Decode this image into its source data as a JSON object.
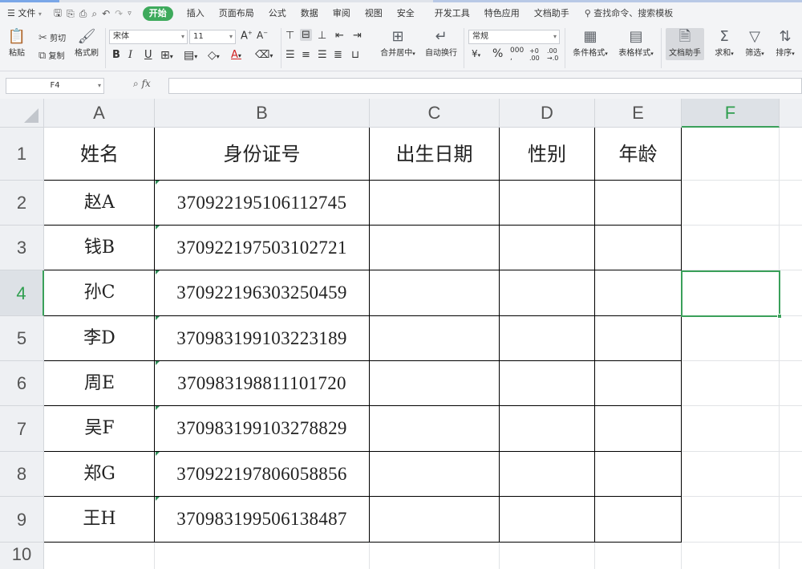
{
  "menu": {
    "file": "文件",
    "tabs": [
      "插入",
      "页面布局",
      "公式",
      "数据",
      "审阅",
      "视图",
      "安全",
      "开发工具",
      "特色应用",
      "文档助手"
    ],
    "active_tab": "开始",
    "search": "查找命令、搜索模板"
  },
  "ribbon": {
    "paste": "粘贴",
    "cut": "剪切",
    "copy": "复制",
    "format_painter": "格式刷",
    "font_name": "宋体",
    "font_size": "11",
    "merge_center": "合并居中",
    "wrap_text": "自动换行",
    "number_format": "常规",
    "conditional_format": "条件格式",
    "table_style": "表格样式",
    "doc_assistant": "文档助手",
    "sum": "求和",
    "filter": "筛选",
    "sort": "排序"
  },
  "formula_bar": {
    "name_box": "F4",
    "fx": "fx",
    "value": ""
  },
  "sheet": {
    "columns": [
      "A",
      "B",
      "C",
      "D",
      "E",
      "F"
    ],
    "active_column": "F",
    "active_row": "4",
    "rows": [
      "1",
      "2",
      "3",
      "4",
      "5",
      "6",
      "7",
      "8",
      "9",
      "10"
    ],
    "headers": [
      "姓名",
      "身份证号",
      "出生日期",
      "性别",
      "年龄"
    ],
    "records": [
      {
        "name": "赵A",
        "id": "370922195106112745"
      },
      {
        "name": "钱B",
        "id": "370922197503102721"
      },
      {
        "name": "孙C",
        "id": "370922196303250459"
      },
      {
        "name": "李D",
        "id": "370983199103223189"
      },
      {
        "name": "周E",
        "id": "370983198811101720"
      },
      {
        "name": "吴F",
        "id": "370983199103278829"
      },
      {
        "name": "郑G",
        "id": "370922197806058856"
      },
      {
        "name": "王H",
        "id": "370983199506138487"
      }
    ]
  },
  "colors": {
    "accent_green": "#3aa05a",
    "header_bg": "#eef0f3"
  }
}
